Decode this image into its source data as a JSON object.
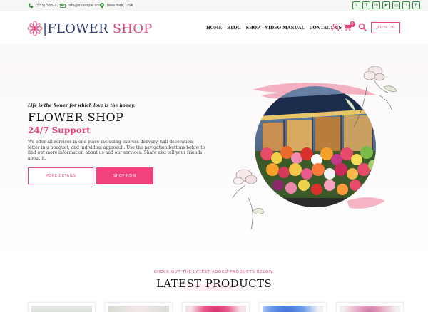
{
  "topbar": {
    "phone": "(555) 555-1234",
    "email": "info@example.com",
    "location": "New York, USA",
    "social": [
      {
        "icon": "x-icon",
        "glyph": "𝕏"
      },
      {
        "icon": "facebook-icon",
        "glyph": "f"
      },
      {
        "icon": "linkedin-icon",
        "glyph": "in"
      },
      {
        "icon": "youtube-icon",
        "glyph": "▶"
      },
      {
        "icon": "instagram-icon",
        "glyph": "◎"
      },
      {
        "icon": "tiktok-icon",
        "glyph": "♪"
      },
      {
        "icon": "pinterest-icon",
        "glyph": "P"
      }
    ]
  },
  "header": {
    "logo_part1": "|FLOWER",
    "logo_part2": " SHOP",
    "nav": [
      "HOME",
      "BLOG",
      "SHOP",
      "VIDEO MANUAL",
      "CONTACT US"
    ],
    "cart_count": "0",
    "join_label": "JOIN US",
    "icons": [
      "user-icon",
      "cart-icon",
      "search-icon"
    ]
  },
  "hero": {
    "tagline": "Life is the flower for which love is the honey.",
    "title": "FLOWER SHOP",
    "subtitle": "24/7 Support",
    "description": "We offer all services in one place including express delivery, hall decoration, letter in a bouquet, and individual approach. Use the navigation buttons below to find out more information about us and our services. Share and tell your friends about it.",
    "btn_more": "MORE DETAILS",
    "btn_shop": "SHOP NOW"
  },
  "latest": {
    "eyebrow": "CHECK OUT THE LATEST ADDED PRODUCTS BELOW.",
    "title": "LATEST PRODUCTS"
  },
  "colors": {
    "accent": "#e2467e",
    "button_pink": "#f0427d",
    "logo_navy": "#2a3a6e",
    "social_green": "#2a8a3a"
  }
}
